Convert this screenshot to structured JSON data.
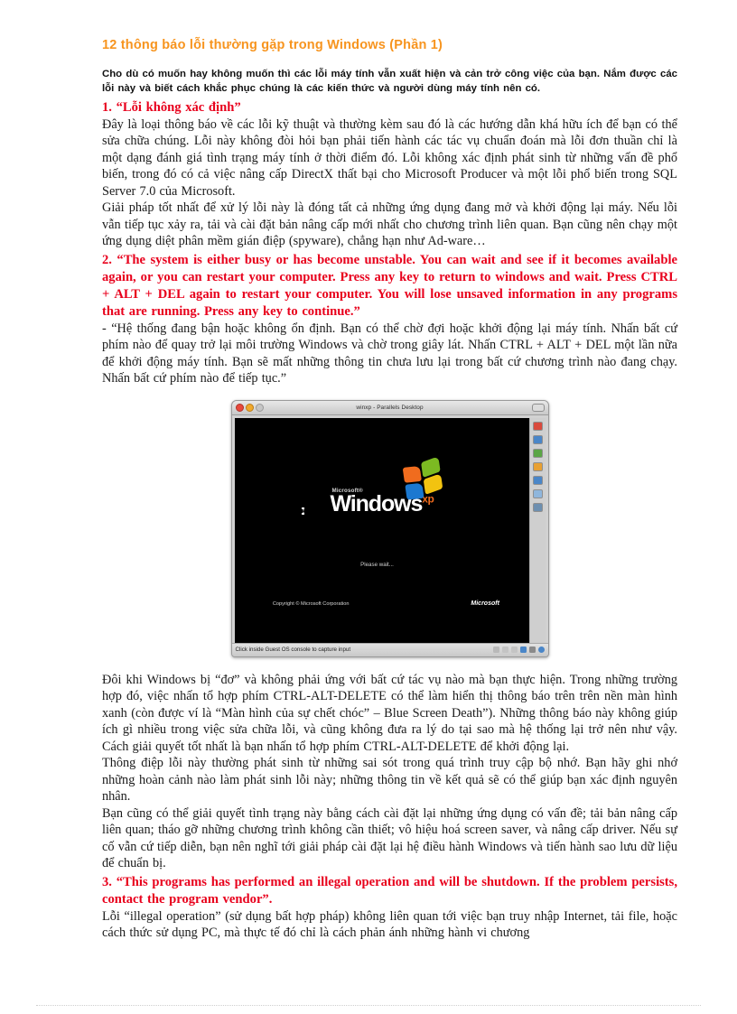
{
  "document": {
    "title": "12 thông báo lỗi thường gặp trong Windows  (Phần 1)",
    "title_color": "#F7941E",
    "accent_red": "#E8001C",
    "lead": "Cho dù có muốn hay không muốn thì các lỗi máy tính vẫn xuất hiện và cản trở công việc của bạn.  Nắm được các lỗi này và biết cách khắc phục chúng là các kiến thức và người dùng máy tính nên có.",
    "sections": [
      {
        "heading": "1. “Lỗi không xác định”",
        "paragraphs": [
          "Đây là loại thông báo về các lỗi kỹ thuật và thường kèm sau đó là các hướng dẫn khá hữu ích để bạn có thể sửa chữa chúng.  Lỗi này không đòi hỏi bạn phải tiến hành các tác vụ chuẩn đoán mà lỗi đơn thuần chỉ là một dạng đánh giá tình trạng máy tính ở thời điểm đó. Lỗi không xác định phát sinh từ những vấn đề phổ biến, trong đó có cả việc nâng cấp DirectX thất bại cho Microsoft Producer và một lỗi phổ biến trong SQL Server 7.0 của Microsoft.",
          "Giải pháp tốt nhất để xử lý lỗi này là đóng tất cả những ứng dụng đang mở và khởi động lại máy. Nếu lỗi vẫn tiếp tục xảy ra, tải và cài đặt bản nâng cấp mới nhất cho chương trình liên quan. Bạn cũng nên chạy một ứng dụng diệt phân mềm gián điệp (spyware), chẳng hạn như Ad-ware…"
        ]
      },
      {
        "heading": "2. “The system is either busy or has become unstable. You  can wait  and  see if it becomes available again, or you can restart your computer.  Press any key to return  to windows  and wait. Press CTRL + ALT + DEL again to restart your  computer.  You  will  lose unsaved information  in any programs  that are running.   Press any key to continue.”",
        "paragraphs": [
          "- “Hệ thống đang bận hoặc không ổn định.  Bạn có thể chờ đợi hoặc khởi động lại máy tính. Nhấn bất cứ phím nào để quay trở lại môi trường Windows và chờ trong giây lát. Nhấn CTRL + ALT + DEL một lần nữa để khởi động máy tính.  Bạn sẽ mất những thông tin chưa lưu lại trong bất cứ chương trình nào đang chạy. Nhấn bất cứ phím nào để tiếp tục.”"
        ]
      }
    ],
    "paragraphs_after_image": [
      "Đôi khi Windows bị “đơ” và không phải ứng với bất cứ tác vụ nào mà bạn thực hiện.  Trong những trường hợp đó, việc nhấn tổ hợp phím CTRL-ALT-DELETE  có thể làm hiển thị thông báo trên trên nền màn hình xanh (còn được ví là “Màn hình của sự chết chóc” – Blue Screen Death”). Những thông báo này không giúp ích gì nhiều trong việc sửa chữa lỗi, và cũng không đưa ra lý do tại sao mà hệ thống lại trở nên như vậy. Cách giải quyết tốt nhất là bạn nhấn tổ hợp phím CTRL-ALT-DELETE  để khởi động lại.",
      "Thông điệp lỗi này thường phát sinh từ những sai sót trong quá trình truy cập bộ nhớ. Bạn hãy ghi nhớ những hoàn cảnh nào làm phát sinh lỗi này; những thông tin về kết quả sẽ có thể giúp bạn xác định nguyên nhân.",
      "Bạn cũng có thể giải quyết tình trạng này bằng cách cài đặt lại những ứng dụng có vấn đề; tải bản nâng cấp liên quan; tháo gỡ những chương trình không cần thiết; vô hiệu hoá screen saver, và nâng cấp driver.  Nếu sự cố vẫn cứ tiếp diễn, bạn nên nghĩ tới giải pháp cài đặt lại hệ điều hành Windows và tiến hành sao lưu dữ liệu để chuẩn bị."
    ],
    "section3": {
      "heading": "3. “This programs  has performed  an illegal operation  and will  be shutdown.  If the problem persists, contact the program  vendor”.",
      "paragraph": "Lỗi “illegal   operation” (sử dụng bất hợp pháp) không liên  quan tới việc bạn truy nhập Internet, tải file,  hoặc cách thức sử dụng PC, mà thực tế đó chỉ là cách phản ánh những hành vi chương"
    }
  },
  "embedded_screenshot": {
    "window_title": "winxp - Parallels Desktop",
    "status_text": "Click inside Guest OS console to capture input",
    "guest": {
      "brand_prefix": "Microsoft®",
      "product": "Windows",
      "product_suffix": "xp",
      "wait_text": "Please wait...",
      "copyright": "Copyright © Microsoft Corporation",
      "watermark": "Microsoft",
      "background": "#000000"
    },
    "traffic_lights": [
      {
        "name": "close",
        "color": "#e8493c"
      },
      {
        "name": "minimize",
        "color": "#f0a92c"
      },
      {
        "name": "zoom",
        "color": "#c6c6c6"
      }
    ],
    "sidebar_tools": [
      {
        "name": "power-off-tool",
        "color": "#d94a3d"
      },
      {
        "name": "network-tool",
        "color": "#4a86c8"
      },
      {
        "name": "play-tool",
        "color": "#5aa545"
      },
      {
        "name": "usb-tool",
        "color": "#e8a032"
      },
      {
        "name": "shared-folder-tool",
        "color": "#4a86c8"
      },
      {
        "name": "display-tool",
        "color": "#8fb6dc"
      },
      {
        "name": "settings-tool",
        "color": "#6d8fb0"
      }
    ],
    "status_icons": [
      {
        "name": "hard-disk-status-icon",
        "color": "#b9b9b9"
      },
      {
        "name": "cdrom-status-icon",
        "color": "#c4c4c4"
      },
      {
        "name": "floppy-status-icon",
        "color": "#c4c4c4"
      },
      {
        "name": "network-status-icon",
        "color": "#4a86c8"
      },
      {
        "name": "sound-status-icon",
        "color": "#8a8a8a"
      },
      {
        "name": "help-status-icon",
        "color": "#4a86c8"
      }
    ]
  }
}
